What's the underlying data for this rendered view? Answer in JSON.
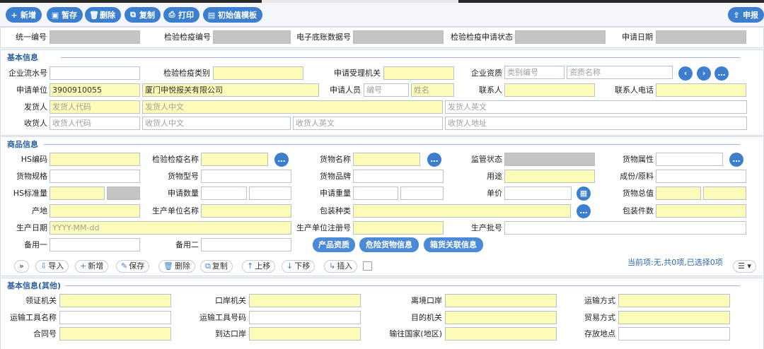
{
  "toolbar": {
    "add": "新增",
    "save_temp": "暂存",
    "delete": "删除",
    "copy": "复制",
    "print": "打印",
    "init_template": "初始值模板",
    "declare": "申报"
  },
  "header": {
    "unified_no": "统一编号",
    "inspection_no": "检验检疫编号",
    "e_ledger_no": "电子底账数据号",
    "inspection_status": "检验检疫申请状态",
    "apply_date": "申请日期"
  },
  "basic": {
    "title": "基本信息",
    "serial_no": "企业流水号",
    "inspection_category": "检验检疫类别",
    "accept_office": "申请受理机关",
    "qualification": "企业资质",
    "qual_code_ph": "类别编号",
    "qual_name_ph": "资质名称",
    "applicant": "申请单位",
    "applicant_code": "3900910055",
    "applicant_name": "厦门申悦报关有限公司",
    "applicant_person": "申请人员",
    "person_code_ph": "编号",
    "person_name_ph": "姓名",
    "contact": "联系人",
    "contact_phone": "联系人电话",
    "consignor": "发货人",
    "consignor_code_ph": "发货人代码",
    "consignor_cn_ph": "发货人中文",
    "consignor_en_ph": "发货人英文",
    "consignee": "收货人",
    "consignee_code_ph": "收货人代码",
    "consignee_cn_ph": "收货人中文",
    "consignee_en_ph": "收货人英文",
    "consignee_addr_ph": "收货人地址"
  },
  "goods": {
    "title": "商品信息",
    "hs_code": "HS编码",
    "insp_name": "检验检疫名称",
    "goods_name": "货物名称",
    "supervision": "监管状态",
    "goods_attr": "货物属性",
    "spec": "货物规格",
    "model": "货物型号",
    "brand": "货物品牌",
    "usage": "用途",
    "ingredient": "成份/原料",
    "hs_qty": "HS标准量",
    "apply_qty": "申请数量",
    "apply_weight": "申请重量",
    "unit_price": "单价",
    "total_value": "货物总值",
    "origin": "产地",
    "producer": "生产单位名称",
    "pack_type": "包装种类",
    "pack_count": "包装件数",
    "prod_date": "生产日期",
    "date_ph": "YYYY-MM-dd",
    "producer_reg": "生产单位注册号",
    "batch_no": "生产批号",
    "spare1": "备用一",
    "spare2": "备用二",
    "product_qual": "产品资质",
    "dangerous_info": "危险货物信息",
    "container_info": "箱货关联信息"
  },
  "grid_toolbar": {
    "expand": "»",
    "import": "导入",
    "add": "新增",
    "save": "保存",
    "delete": "删除",
    "copy": "复制",
    "up": "上移",
    "down": "下移",
    "insert": "插入",
    "status": "当前项:无,共0项,已选择0项",
    "menu": "☰ ▾"
  },
  "other": {
    "title": "基本信息(其他)",
    "license_office": "领证机关",
    "port_office": "口岸机关",
    "exit_port": "离境口岸",
    "transport_mode": "运输方式",
    "vehicle_name": "运输工具名称",
    "vehicle_no": "运输工具号码",
    "dest_office": "目的机关",
    "trade_mode": "贸易方式",
    "contract_no": "合同号",
    "arrival_port": "到达口岸",
    "dest_country": "输往国家(地区)",
    "storage_place": "存放地点"
  },
  "colors": {
    "accent": "#3d7fcf",
    "required": "#fdfbb8",
    "readonly": "#c4c4c4"
  }
}
